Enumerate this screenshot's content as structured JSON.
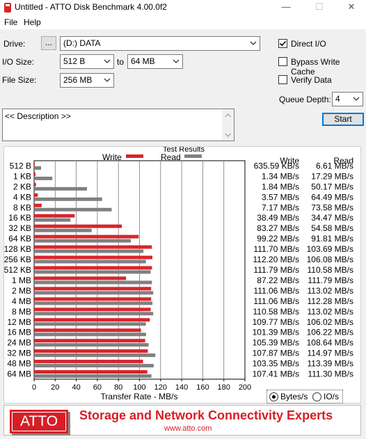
{
  "window": {
    "title": "Untitled - ATTO Disk Benchmark 4.00.0f2",
    "min_glyph": "—",
    "max_glyph": "☐",
    "close_glyph": "✕"
  },
  "menu": [
    "File",
    "Help"
  ],
  "controls": {
    "drive_label": "Drive:",
    "browse_label": "...",
    "drive_value": "(D:) DATA",
    "io_size_label": "I/O Size:",
    "io_from": "512 B",
    "io_to_label": "to",
    "io_to": "64 MB",
    "file_size_label": "File Size:",
    "file_size": "256 MB",
    "direct_io_label": "Direct I/O",
    "direct_io_checked": true,
    "bypass_cache_label": "Bypass Write Cache",
    "bypass_cache_checked": false,
    "verify_label": "Verify Data",
    "verify_checked": false,
    "queue_depth_label": "Queue Depth:",
    "queue_depth": "4",
    "start_label": "Start",
    "description_text": "<< Description >>"
  },
  "chart_data": {
    "type": "bar",
    "title": "Test Results",
    "xlabel": "Transfer Rate - MB/s",
    "xlim": [
      0,
      200
    ],
    "x_ticks": [
      0,
      20,
      40,
      60,
      80,
      100,
      120,
      140,
      160,
      180,
      200
    ],
    "grid": "vertical",
    "legend": [
      {
        "name": "Write",
        "color": "#d7262b"
      },
      {
        "name": "Read",
        "color": "#808080"
      }
    ],
    "categories": [
      "512 B",
      "1 KB",
      "2 KB",
      "4 KB",
      "8 KB",
      "16 KB",
      "32 KB",
      "64 KB",
      "128 KB",
      "256 KB",
      "512 KB",
      "1 MB",
      "2 MB",
      "4 MB",
      "8 MB",
      "12 MB",
      "16 MB",
      "24 MB",
      "32 MB",
      "48 MB",
      "64 MB"
    ],
    "series": [
      {
        "name": "Write",
        "values": [
          0.636,
          1.34,
          1.84,
          3.57,
          7.17,
          38.49,
          83.27,
          99.22,
          111.7,
          112.2,
          111.79,
          87.22,
          111.06,
          111.06,
          110.58,
          109.77,
          101.39,
          105.39,
          107.87,
          103.35,
          107.41
        ]
      },
      {
        "name": "Read",
        "values": [
          6.61,
          17.29,
          50.17,
          64.49,
          73.58,
          34.47,
          54.58,
          91.81,
          103.69,
          106.08,
          110.58,
          111.79,
          113.02,
          112.28,
          113.02,
          106.02,
          106.22,
          108.64,
          114.97,
          113.39,
          111.3
        ]
      }
    ],
    "table_headers": [
      "Write",
      "Read"
    ],
    "write_text": [
      "635.59 KB/s",
      "1.34 MB/s",
      "1.84 MB/s",
      "3.57 MB/s",
      "7.17 MB/s",
      "38.49 MB/s",
      "83.27 MB/s",
      "99.22 MB/s",
      "111.70 MB/s",
      "112.20 MB/s",
      "111.79 MB/s",
      "87.22 MB/s",
      "111.06 MB/s",
      "111.06 MB/s",
      "110.58 MB/s",
      "109.77 MB/s",
      "101.39 MB/s",
      "105.39 MB/s",
      "107.87 MB/s",
      "103.35 MB/s",
      "107.41 MB/s"
    ],
    "read_text": [
      "6.61 MB/s",
      "17.29 MB/s",
      "50.17 MB/s",
      "64.49 MB/s",
      "73.58 MB/s",
      "34.47 MB/s",
      "54.58 MB/s",
      "91.81 MB/s",
      "103.69 MB/s",
      "106.08 MB/s",
      "110.58 MB/s",
      "111.79 MB/s",
      "113.02 MB/s",
      "112.28 MB/s",
      "113.02 MB/s",
      "106.02 MB/s",
      "106.22 MB/s",
      "108.64 MB/s",
      "114.97 MB/s",
      "113.39 MB/s",
      "111.30 MB/s"
    ]
  },
  "units": {
    "bytes_label": "Bytes/s",
    "io_label": "IO/s",
    "selected": "Bytes/s"
  },
  "footer": {
    "logo_text": "ATTO",
    "tagline": "Storage and Network Connectivity Experts",
    "website": "www.atto.com"
  }
}
